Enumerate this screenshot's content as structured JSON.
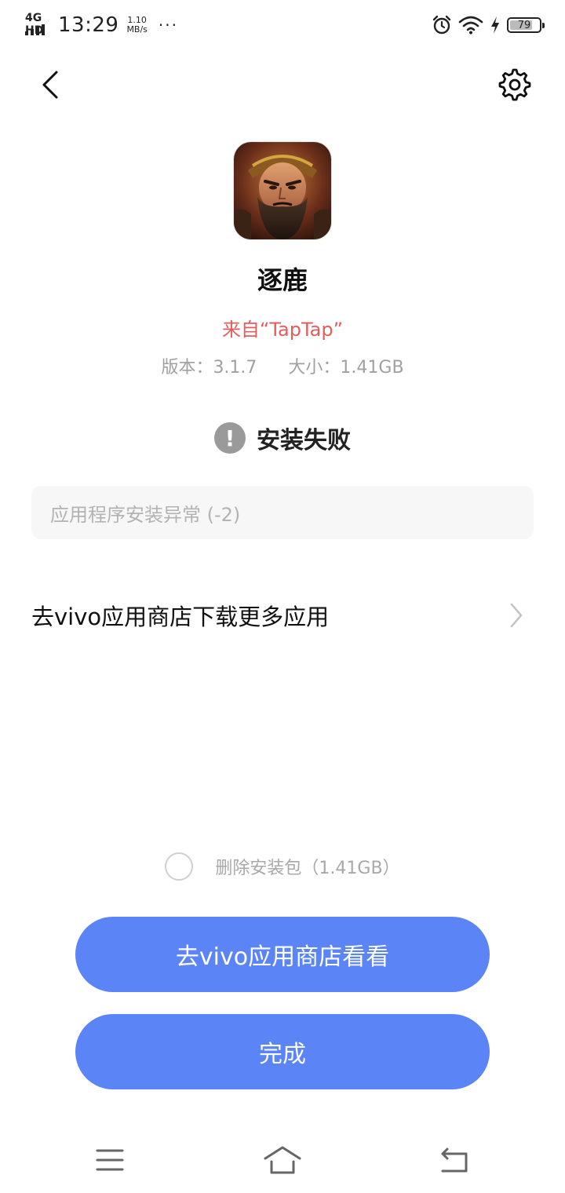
{
  "status_bar": {
    "network": "4G HD",
    "time": "13:29",
    "speed_value": "1.10",
    "speed_unit": "MB/s",
    "more": "···",
    "battery": "79",
    "icons": [
      "alarm-icon",
      "wifi-icon",
      "charging-icon",
      "battery-icon"
    ]
  },
  "header": {
    "back_icon": "chevron-left-icon",
    "settings_icon": "gear-icon"
  },
  "app": {
    "icon": "app-icon-warrior-portrait",
    "name": "逐鹿",
    "source": "来自“TapTap”",
    "version": "版本：3.1.7",
    "size": "大小：1.41GB"
  },
  "install_status": {
    "icon": "exclamation-icon",
    "text": "安装失败",
    "error_message": "应用程序安装异常 (-2)"
  },
  "store_link": {
    "label": "去vivo应用商店下载更多应用",
    "icon": "chevron-right-icon"
  },
  "delete_package": {
    "label": "删除安装包（1.41GB）",
    "checked": false
  },
  "buttons": {
    "store": "去vivo应用商店看看",
    "done": "完成"
  },
  "nav_bar": {
    "icons": [
      "menu-icon",
      "home-icon",
      "back-icon"
    ]
  },
  "colors": {
    "accent": "#5b84f7",
    "source_text": "#e35d5d",
    "muted": "#a0a0a0"
  }
}
